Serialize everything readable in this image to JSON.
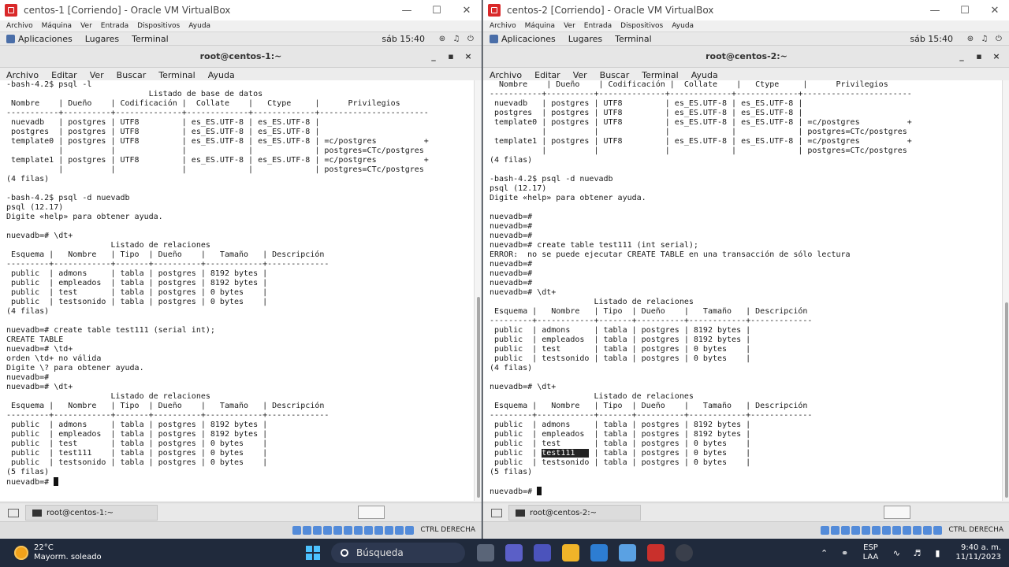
{
  "vm1": {
    "window_title": "centos-1 [Corriendo] - Oracle VM VirtualBox",
    "vbox_menu": [
      "Archivo",
      "Máquina",
      "Ver",
      "Entrada",
      "Dispositivos",
      "Ayuda"
    ],
    "gnome": {
      "apps": "Aplicaciones",
      "places": "Lugares",
      "terminal": "Terminal",
      "time": "sáb 15:40"
    },
    "terminal_title": "root@centos-1:~",
    "terminal_menu": [
      "Archivo",
      "Editar",
      "Ver",
      "Buscar",
      "Terminal",
      "Ayuda"
    ],
    "terminal_text": "-bash-4.2$ psql -l\n                              Listado de base de datos\n Nombre    | Dueño    | Codificación |  Collate    |   Ctype     |      Privilegios\n-----------+----------+--------------+-------------+-------------+-----------------------\n nuevadb   | postgres | UTF8         | es_ES.UTF-8 | es_ES.UTF-8 |\n postgres  | postgres | UTF8         | es_ES.UTF-8 | es_ES.UTF-8 |\n template0 | postgres | UTF8         | es_ES.UTF-8 | es_ES.UTF-8 | =c/postgres          +\n           |          |              |             |             | postgres=CTc/postgres\n template1 | postgres | UTF8         | es_ES.UTF-8 | es_ES.UTF-8 | =c/postgres          +\n           |          |              |             |             | postgres=CTc/postgres\n(4 filas)\n\n-bash-4.2$ psql -d nuevadb\npsql (12.17)\nDigite «help» para obtener ayuda.\n\nnuevadb=# \\dt+\n                      Listado de relaciones\n Esquema |   Nombre   | Tipo  | Dueño    |   Tamaño   | Descripción\n---------+------------+-------+----------+------------+-------------\n public  | admons     | tabla | postgres | 8192 bytes |\n public  | empleados  | tabla | postgres | 8192 bytes |\n public  | test       | tabla | postgres | 0 bytes    |\n public  | testsonido | tabla | postgres | 0 bytes    |\n(4 filas)\n\nnuevadb=# create table test111 (serial int);\nCREATE TABLE\nnuevadb=# \\td+\norden \\td+ no válida\nDigite \\? para obtener ayuda.\nnuevadb=#\nnuevadb=# \\dt+\n                      Listado de relaciones\n Esquema |   Nombre   | Tipo  | Dueño    |   Tamaño   | Descripción\n---------+------------+-------+----------+------------+-------------\n public  | admons     | tabla | postgres | 8192 bytes |\n public  | empleados  | tabla | postgres | 8192 bytes |\n public  | test       | tabla | postgres | 0 bytes    |\n public  | test111    | tabla | postgres | 0 bytes    |\n public  | testsonido | tabla | postgres | 0 bytes    |\n(5 filas)\n",
    "prompt": "nuevadb=# ",
    "taskbar_item": "root@centos-1:~",
    "host_key": "CTRL DERECHA"
  },
  "vm2": {
    "window_title": "centos-2 [Corriendo] - Oracle VM VirtualBox",
    "vbox_menu": [
      "Archivo",
      "Máquina",
      "Ver",
      "Entrada",
      "Dispositivos",
      "Ayuda"
    ],
    "gnome": {
      "apps": "Aplicaciones",
      "places": "Lugares",
      "terminal": "Terminal",
      "time": "sáb 15:40"
    },
    "terminal_title": "root@centos-2:~",
    "terminal_menu": [
      "Archivo",
      "Editar",
      "Ver",
      "Buscar",
      "Terminal",
      "Ayuda"
    ],
    "terminal_text_before": "  Nombre    | Dueño    | Codificación |  Collate    |   Ctype     |      Privilegios\n-----------+----------+--------------+-------------+-------------+-----------------------\n nuevadb   | postgres | UTF8         | es_ES.UTF-8 | es_ES.UTF-8 |\n postgres  | postgres | UTF8         | es_ES.UTF-8 | es_ES.UTF-8 |\n template0 | postgres | UTF8         | es_ES.UTF-8 | es_ES.UTF-8 | =c/postgres          +\n           |          |              |             |             | postgres=CTc/postgres\n template1 | postgres | UTF8         | es_ES.UTF-8 | es_ES.UTF-8 | =c/postgres          +\n           |          |              |             |             | postgres=CTc/postgres\n(4 filas)\n\n-bash-4.2$ psql -d nuevadb\npsql (12.17)\nDigite «help» para obtener ayuda.\n\nnuevadb=#\nnuevadb=#\nnuevadb=#\nnuevadb=# create table test111 (int serial);\nERROR:  no se puede ejecutar CREATE TABLE en una transacción de sólo lectura\nnuevadb=#\nnuevadb=#\nnuevadb=#\nnuevadb=# \\dt+\n                      Listado de relaciones\n Esquema |   Nombre   | Tipo  | Dueño    |   Tamaño   | Descripción\n---------+------------+-------+----------+------------+-------------\n public  | admons     | tabla | postgres | 8192 bytes |\n public  | empleados  | tabla | postgres | 8192 bytes |\n public  | test       | tabla | postgres | 0 bytes    |\n public  | testsonido | tabla | postgres | 0 bytes    |\n(4 filas)\n\nnuevadb=# \\dt+\n                      Listado de relaciones\n Esquema |   Nombre   | Tipo  | Dueño    |   Tamaño   | Descripción\n---------+------------+-------+----------+------------+-------------\n public  | admons     | tabla | postgres | 8192 bytes |\n public  | empleados  | tabla | postgres | 8192 bytes |\n public  | test       | tabla | postgres | 0 bytes    |\n public  | ",
    "highlight": "test111   ",
    "terminal_text_after": " | tabla | postgres | 0 bytes    |\n public  | testsonido | tabla | postgres | 0 bytes    |\n(5 filas)\n\n",
    "prompt": "nuevadb=# ",
    "taskbar_item": "root@centos-2:~",
    "host_key": "CTRL DERECHA"
  },
  "windows": {
    "weather_temp": "22°C",
    "weather_desc": "Mayorm. soleado",
    "search_label": "Búsqueda",
    "lang_top": "ESP",
    "lang_bottom": "LAA",
    "time": "9:40 a. m.",
    "date": "11/11/2023"
  },
  "colors": {
    "terminal_bg": "#ffffff",
    "taskbar_bg": "#202a3c",
    "vbox_icon": "#d9292a",
    "accent": "#4cc2ff"
  }
}
